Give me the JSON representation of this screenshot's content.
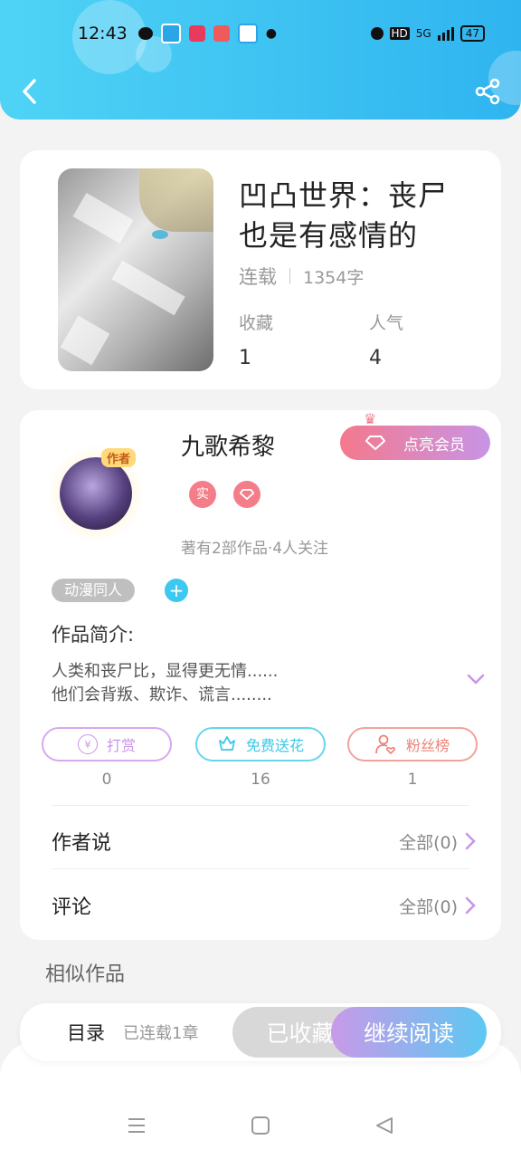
{
  "status_bar": {
    "time": "12:43",
    "icons": [
      "wechat-icon",
      "app-icon",
      "video-icon",
      "app2-icon",
      "app3-icon"
    ],
    "right_hd": "HD",
    "right_signal": "5G",
    "battery": "47"
  },
  "book": {
    "title": "凹凸世界：丧尸也是有感情的",
    "status": "连载",
    "words": "1354字",
    "favorites_label": "收藏",
    "favorites_value": "1",
    "popularity_label": "人气",
    "popularity_value": "4"
  },
  "author": {
    "badge": "作者",
    "name": "九歌希黎",
    "vip_button": "点亮会员",
    "tag_real": "实",
    "works": "著有2部作品·4人关注",
    "category": "动漫同人",
    "plus": "+"
  },
  "intro": {
    "label": "作品简介:",
    "line1": "人类和丧尸比，显得更无情......",
    "line2": "他们会背叛、欺诈、谎言........"
  },
  "actions": {
    "reward_label": "打赏",
    "reward_icon_text": "¥",
    "reward_count": "0",
    "flower_label": "免费送花",
    "flower_count": "16",
    "fans_label": "粉丝榜",
    "fans_count": "1"
  },
  "rows": {
    "author_says": "作者说",
    "author_says_count": "全部(0)",
    "comments": "评论",
    "comments_count": "全部(0)"
  },
  "similar_label": "相似作品",
  "bottom": {
    "toc": "目录",
    "toc_status": "已连载1章",
    "favorited": "已收藏",
    "continue": "继续阅读"
  },
  "colors": {
    "header": "#2fb4f0",
    "accent_pink": "#f47d8a",
    "accent_blue": "#3cc8ef",
    "reward": "#c894e6",
    "flower": "#4fd0e8",
    "fans": "#f08a80"
  }
}
